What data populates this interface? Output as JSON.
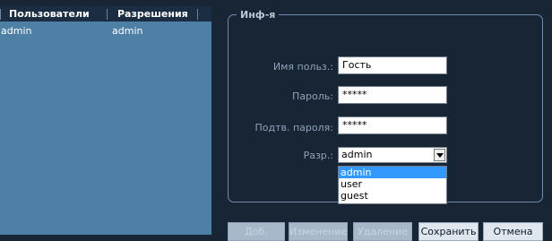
{
  "users_table": {
    "headers": [
      "Пользователи",
      "Разрешения"
    ],
    "rows": [
      {
        "user": "admin",
        "permission": "admin"
      }
    ]
  },
  "info": {
    "legend": "Инф-я",
    "username": {
      "label": "Имя польз.:",
      "value": "Гость"
    },
    "password": {
      "label": "Пароль:",
      "value": "*****"
    },
    "confirm_password": {
      "label": "Подтв. пароля:",
      "value": "*****"
    },
    "permission": {
      "label": "Разр.:",
      "selected": "admin",
      "options": [
        "admin",
        "user",
        "guest"
      ]
    }
  },
  "buttons": {
    "add": "Доб.",
    "modify": "Изменение",
    "delete": "Удаление",
    "save": "Сохранить",
    "cancel": "Отмена"
  },
  "colors": {
    "background": "#182534",
    "users_panel": "#4e7fa5",
    "header": "#1a2d43",
    "selected_option": "#3399ff"
  }
}
